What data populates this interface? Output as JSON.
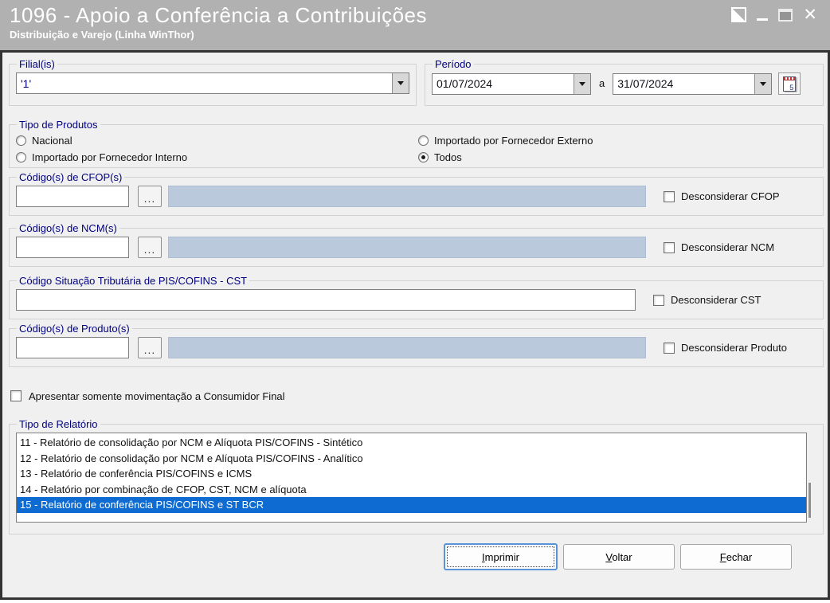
{
  "window": {
    "title": "1096 - Apoio a Conferência a Contribuições",
    "subtitle": "Distribuição e Varejo (Linha WinThor)",
    "close_glyph": "✕"
  },
  "filial": {
    "legend": "Filial(is)",
    "value": "'1'"
  },
  "periodo": {
    "legend": "Período",
    "start": "01/07/2024",
    "separator": "a",
    "end": "31/07/2024",
    "calendar_day": "5"
  },
  "tipo_produtos": {
    "legend": "Tipo de Produtos",
    "options": [
      {
        "label": "Nacional",
        "selected": false
      },
      {
        "label": "Importado por Fornecedor Interno",
        "selected": false
      },
      {
        "label": "Importado por Fornecedor Externo",
        "selected": false
      },
      {
        "label": "Todos",
        "selected": true
      }
    ]
  },
  "cfop": {
    "legend": "Código(s) de CFOP(s)",
    "code_value": "",
    "browse_label": "...",
    "list_value": "",
    "check_label": "Desconsiderar CFOP",
    "checked": false
  },
  "ncm": {
    "legend": "Código(s) de NCM(s)",
    "code_value": "",
    "browse_label": "...",
    "list_value": "",
    "check_label": "Desconsiderar NCM",
    "checked": false
  },
  "cst": {
    "legend": "Código Situação Tributária de PIS/COFINS - CST",
    "value": "",
    "check_label": "Desconsiderar CST",
    "checked": false
  },
  "produto": {
    "legend": "Código(s) de Produto(s)",
    "code_value": "",
    "browse_label": "...",
    "list_value": "",
    "check_label": "Desconsiderar Produto",
    "checked": false
  },
  "consumidor_final": {
    "label": "Apresentar somente movimentação a Consumidor Final",
    "checked": false
  },
  "relatorio": {
    "legend": "Tipo de Relatório",
    "items": [
      {
        "label": "11 - Relatório de consolidação por NCM e Alíquota PIS/COFINS - Sintético",
        "selected": false
      },
      {
        "label": "12 - Relatório de consolidação por NCM e Alíquota PIS/COFINS - Analítico",
        "selected": false
      },
      {
        "label": "13 - Relatório de conferência PIS/COFINS e ICMS",
        "selected": false
      },
      {
        "label": "14 - Relatório por combinação de CFOP, CST, NCM e alíquota",
        "selected": false
      },
      {
        "label": "15 - Relatório de conferência PIS/COFINS e ST BCR",
        "selected": true
      }
    ]
  },
  "buttons": [
    {
      "accel": "I",
      "rest": "mprimir",
      "focused": true
    },
    {
      "accel": "V",
      "rest": "oltar",
      "focused": false
    },
    {
      "accel": "F",
      "rest": "echar",
      "focused": false
    }
  ],
  "colors": {
    "titlebar": "#b1b1b1",
    "caption": "#000080",
    "selection_blue": "#0d6bd1",
    "annotation_red": "#e8161c",
    "disabled_field": "#bac9db"
  }
}
